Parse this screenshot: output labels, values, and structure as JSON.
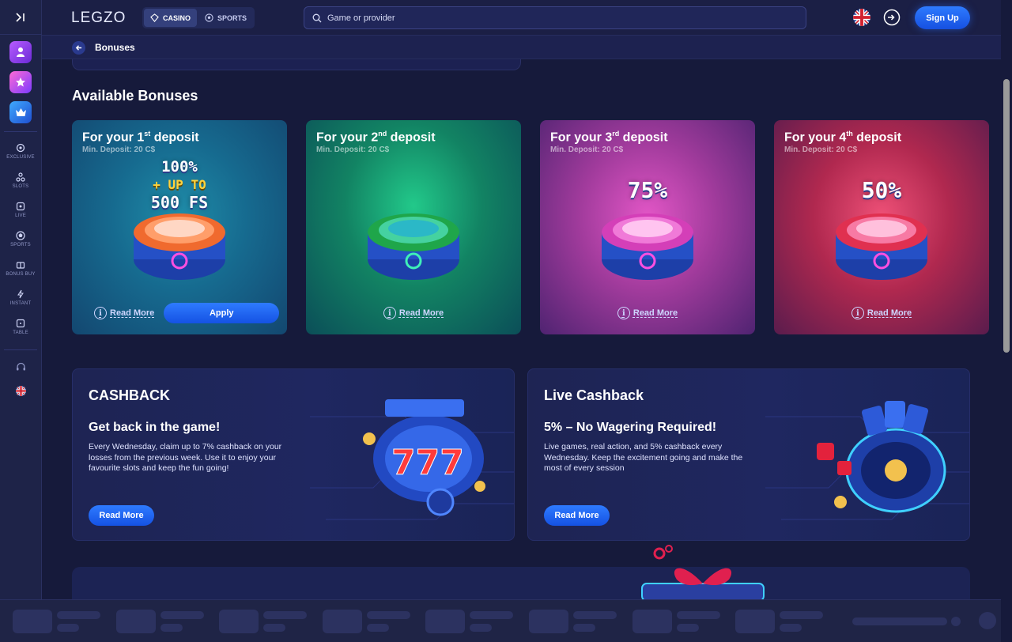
{
  "sidebar": {
    "items": [
      {
        "label": "EXCLUSIVE",
        "icon": "exclusive-icon"
      },
      {
        "label": "SLOTS",
        "icon": "slots-icon"
      },
      {
        "label": "LIVE",
        "icon": "live-icon"
      },
      {
        "label": "SPORTS",
        "icon": "sports-icon"
      },
      {
        "label": "BONUS BUY",
        "icon": "bonus-buy-icon"
      },
      {
        "label": "INSTANT",
        "icon": "instant-icon"
      },
      {
        "label": "TABLE",
        "icon": "table-icon"
      }
    ]
  },
  "header": {
    "logo": "LEGZO",
    "modes": {
      "casino": "CASINO",
      "sports": "SPORTS"
    },
    "search_placeholder": "Game or provider",
    "signup_label": "Sign Up"
  },
  "subheader": {
    "title": "Bonuses"
  },
  "bonuses": {
    "title": "Available Bonuses",
    "cards": [
      {
        "title_pre": "For your 1",
        "title_sup": "st",
        "title_post": " deposit",
        "min_deposit": "Min. Deposit: 20 C$",
        "promo_line1": "100%",
        "promo_line2": "+ UP TO",
        "promo_line3": "500 FS",
        "read_more": "Read More",
        "apply": "Apply"
      },
      {
        "title_pre": "For your 2",
        "title_sup": "nd",
        "title_post": " deposit",
        "min_deposit": "Min. Deposit: 20 C$",
        "read_more": "Read More"
      },
      {
        "title_pre": "For your 3",
        "title_sup": "rd",
        "title_post": " deposit",
        "min_deposit": "Min. Deposit: 20 C$",
        "promo": "75%",
        "read_more": "Read More"
      },
      {
        "title_pre": "For your 4",
        "title_sup": "th",
        "title_post": " deposit",
        "min_deposit": "Min. Deposit: 20 C$",
        "promo": "50%",
        "read_more": "Read More"
      }
    ]
  },
  "promos": [
    {
      "title": "CASHBACK",
      "subtitle": "Get back in the game!",
      "description": "Every Wednesday, claim up to 7% cashback on your losses from the previous week. Use it to enjoy your favourite slots and keep the fun going!",
      "button": "Read More"
    },
    {
      "title": "Live Cashback",
      "subtitle": "5% – No Wagering Required!",
      "description": "Live games, real action, and 5% cashback every Wednesday. Keep the excitement going and make the most of every session",
      "button": "Read More"
    }
  ],
  "colors": {
    "accent": "#2e7bff",
    "background": "#161a3b"
  }
}
